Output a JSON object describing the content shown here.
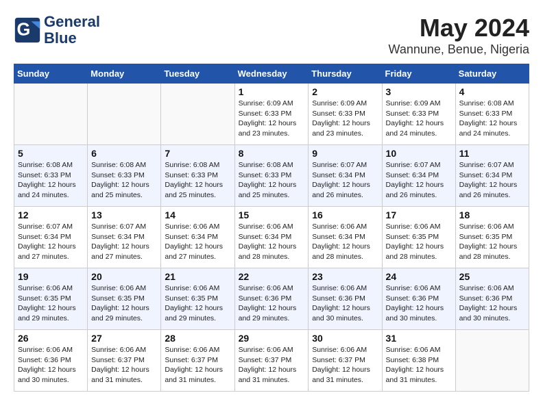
{
  "header": {
    "logo_line1": "General",
    "logo_line2": "Blue",
    "month_year": "May 2024",
    "location": "Wannune, Benue, Nigeria"
  },
  "weekdays": [
    "Sunday",
    "Monday",
    "Tuesday",
    "Wednesday",
    "Thursday",
    "Friday",
    "Saturday"
  ],
  "weeks": [
    [
      {
        "day": "",
        "info": ""
      },
      {
        "day": "",
        "info": ""
      },
      {
        "day": "",
        "info": ""
      },
      {
        "day": "1",
        "info": "Sunrise: 6:09 AM\nSunset: 6:33 PM\nDaylight: 12 hours\nand 23 minutes."
      },
      {
        "day": "2",
        "info": "Sunrise: 6:09 AM\nSunset: 6:33 PM\nDaylight: 12 hours\nand 23 minutes."
      },
      {
        "day": "3",
        "info": "Sunrise: 6:09 AM\nSunset: 6:33 PM\nDaylight: 12 hours\nand 24 minutes."
      },
      {
        "day": "4",
        "info": "Sunrise: 6:08 AM\nSunset: 6:33 PM\nDaylight: 12 hours\nand 24 minutes."
      }
    ],
    [
      {
        "day": "5",
        "info": "Sunrise: 6:08 AM\nSunset: 6:33 PM\nDaylight: 12 hours\nand 24 minutes."
      },
      {
        "day": "6",
        "info": "Sunrise: 6:08 AM\nSunset: 6:33 PM\nDaylight: 12 hours\nand 25 minutes."
      },
      {
        "day": "7",
        "info": "Sunrise: 6:08 AM\nSunset: 6:33 PM\nDaylight: 12 hours\nand 25 minutes."
      },
      {
        "day": "8",
        "info": "Sunrise: 6:08 AM\nSunset: 6:33 PM\nDaylight: 12 hours\nand 25 minutes."
      },
      {
        "day": "9",
        "info": "Sunrise: 6:07 AM\nSunset: 6:34 PM\nDaylight: 12 hours\nand 26 minutes."
      },
      {
        "day": "10",
        "info": "Sunrise: 6:07 AM\nSunset: 6:34 PM\nDaylight: 12 hours\nand 26 minutes."
      },
      {
        "day": "11",
        "info": "Sunrise: 6:07 AM\nSunset: 6:34 PM\nDaylight: 12 hours\nand 26 minutes."
      }
    ],
    [
      {
        "day": "12",
        "info": "Sunrise: 6:07 AM\nSunset: 6:34 PM\nDaylight: 12 hours\nand 27 minutes."
      },
      {
        "day": "13",
        "info": "Sunrise: 6:07 AM\nSunset: 6:34 PM\nDaylight: 12 hours\nand 27 minutes."
      },
      {
        "day": "14",
        "info": "Sunrise: 6:06 AM\nSunset: 6:34 PM\nDaylight: 12 hours\nand 27 minutes."
      },
      {
        "day": "15",
        "info": "Sunrise: 6:06 AM\nSunset: 6:34 PM\nDaylight: 12 hours\nand 28 minutes."
      },
      {
        "day": "16",
        "info": "Sunrise: 6:06 AM\nSunset: 6:34 PM\nDaylight: 12 hours\nand 28 minutes."
      },
      {
        "day": "17",
        "info": "Sunrise: 6:06 AM\nSunset: 6:35 PM\nDaylight: 12 hours\nand 28 minutes."
      },
      {
        "day": "18",
        "info": "Sunrise: 6:06 AM\nSunset: 6:35 PM\nDaylight: 12 hours\nand 28 minutes."
      }
    ],
    [
      {
        "day": "19",
        "info": "Sunrise: 6:06 AM\nSunset: 6:35 PM\nDaylight: 12 hours\nand 29 minutes."
      },
      {
        "day": "20",
        "info": "Sunrise: 6:06 AM\nSunset: 6:35 PM\nDaylight: 12 hours\nand 29 minutes."
      },
      {
        "day": "21",
        "info": "Sunrise: 6:06 AM\nSunset: 6:35 PM\nDaylight: 12 hours\nand 29 minutes."
      },
      {
        "day": "22",
        "info": "Sunrise: 6:06 AM\nSunset: 6:36 PM\nDaylight: 12 hours\nand 29 minutes."
      },
      {
        "day": "23",
        "info": "Sunrise: 6:06 AM\nSunset: 6:36 PM\nDaylight: 12 hours\nand 30 minutes."
      },
      {
        "day": "24",
        "info": "Sunrise: 6:06 AM\nSunset: 6:36 PM\nDaylight: 12 hours\nand 30 minutes."
      },
      {
        "day": "25",
        "info": "Sunrise: 6:06 AM\nSunset: 6:36 PM\nDaylight: 12 hours\nand 30 minutes."
      }
    ],
    [
      {
        "day": "26",
        "info": "Sunrise: 6:06 AM\nSunset: 6:36 PM\nDaylight: 12 hours\nand 30 minutes."
      },
      {
        "day": "27",
        "info": "Sunrise: 6:06 AM\nSunset: 6:37 PM\nDaylight: 12 hours\nand 31 minutes."
      },
      {
        "day": "28",
        "info": "Sunrise: 6:06 AM\nSunset: 6:37 PM\nDaylight: 12 hours\nand 31 minutes."
      },
      {
        "day": "29",
        "info": "Sunrise: 6:06 AM\nSunset: 6:37 PM\nDaylight: 12 hours\nand 31 minutes."
      },
      {
        "day": "30",
        "info": "Sunrise: 6:06 AM\nSunset: 6:37 PM\nDaylight: 12 hours\nand 31 minutes."
      },
      {
        "day": "31",
        "info": "Sunrise: 6:06 AM\nSunset: 6:38 PM\nDaylight: 12 hours\nand 31 minutes."
      },
      {
        "day": "",
        "info": ""
      }
    ]
  ]
}
